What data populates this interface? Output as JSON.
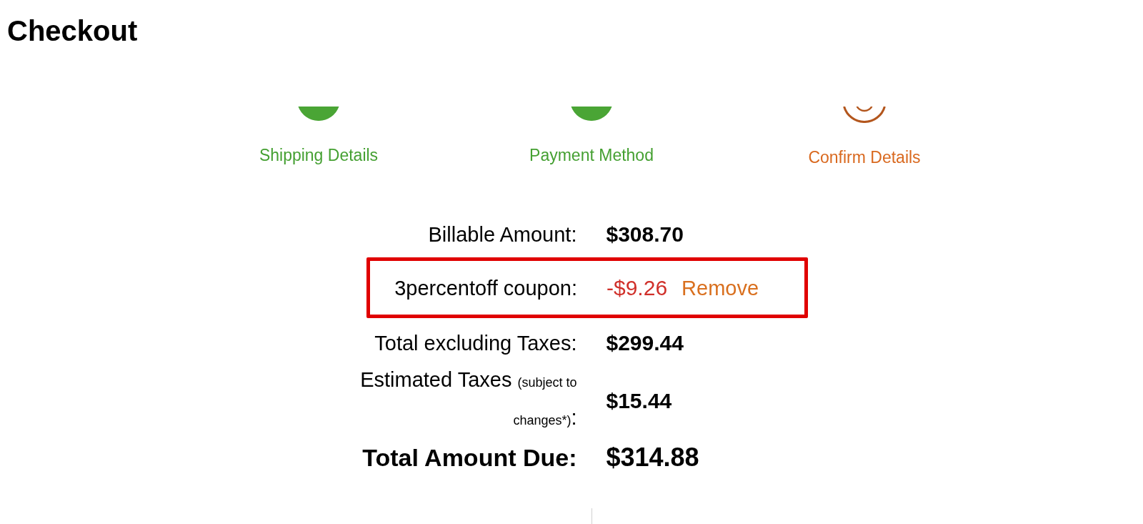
{
  "page": {
    "title": "Checkout"
  },
  "steps": [
    {
      "label": "Shipping Details",
      "completed": true
    },
    {
      "label": "Payment Method",
      "completed": true
    },
    {
      "label": "Confirm Details",
      "completed": false
    }
  ],
  "summary": {
    "rows": [
      {
        "kind": "amount",
        "label": "Billable Amount:",
        "value": "$308.70"
      },
      {
        "kind": "coupon",
        "label": "3percentoff coupon:",
        "value": "-$9.26",
        "action": "Remove",
        "highlighted": true
      },
      {
        "kind": "amount",
        "label": "Total excluding Taxes:",
        "value": "$299.44"
      },
      {
        "kind": "taxes",
        "label": "Estimated Taxes",
        "note": "(subject to changes*)",
        "suffix": ":",
        "value": "$15.44"
      },
      {
        "kind": "total",
        "label": "Total Amount Due:",
        "value": "$314.88"
      }
    ]
  }
}
